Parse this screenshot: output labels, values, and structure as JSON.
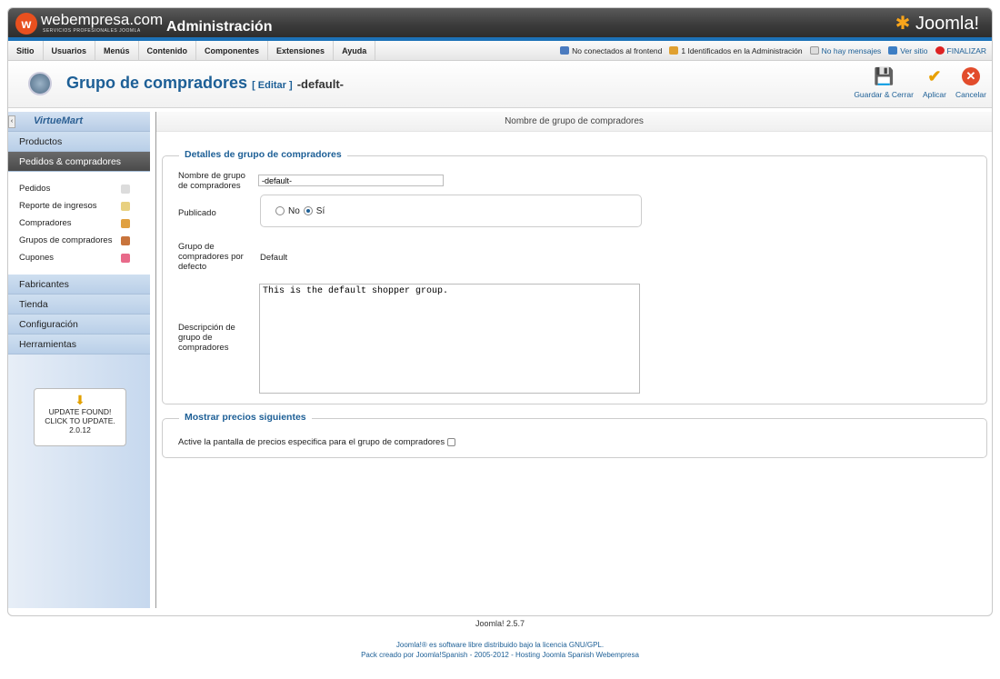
{
  "header": {
    "brand": "webempresa.com",
    "brand_sub": "SERVICIOS PROFESIONALES JOOMLA",
    "logo_letter": "w",
    "title": "Administración",
    "joomla_logo": "Joomla!"
  },
  "menu": {
    "items": [
      "Sitio",
      "Usuarios",
      "Menús",
      "Contenido",
      "Componentes",
      "Extensiones",
      "Ayuda"
    ]
  },
  "status": {
    "frontend": "No conectados al frontend",
    "admin": "1 Identificados en la Administración",
    "messages": "No hay mensajes",
    "view_site": "Ver sitio",
    "logout": "FINALIZAR"
  },
  "toolbar": {
    "title": "Grupo de compradores",
    "edit": "[ Editar ]",
    "record": "-default-",
    "save_close": "Guardar & Cerrar",
    "apply": "Aplicar",
    "cancel": "Cancelar"
  },
  "sidebar": {
    "logo": "VirtueMart",
    "sections": [
      "Productos",
      "Pedidos & compradores",
      "Fabricantes",
      "Tienda",
      "Configuración",
      "Herramientas"
    ],
    "subitems": [
      "Pedidos",
      "Reporte de ingresos",
      "Compradores",
      "Grupos de compradores",
      "Cupones"
    ],
    "update": {
      "line1": "UPDATE FOUND!",
      "line2": "CLICK TO UPDATE.",
      "version": "2.0.12"
    }
  },
  "main": {
    "heading": "Nombre de grupo de compradores",
    "details_legend": "Detalles de grupo de compradores",
    "name_label": "Nombre de grupo de compradores",
    "name_value": "-default-",
    "published_label": "Publicado",
    "no": "No",
    "yes": "Sí",
    "default_label": "Grupo de compradores por defecto",
    "default_value": "Default",
    "desc_label": "Descripción de grupo de compradores",
    "desc_value": "This is the default shopper group.",
    "prices_legend": "Mostrar precios siguientes",
    "prices_label": "Active la pantalla de precios especifica para el grupo de compradores"
  },
  "footer": {
    "version": "Joomla! 2.5.7",
    "license": "Joomla!® es software libre distribuido bajo la licencia GNU/GPL.",
    "pack": "Pack creado por Joomla!Spanish - 2005-2012 - Hosting Joomla Spanish Webempresa"
  }
}
